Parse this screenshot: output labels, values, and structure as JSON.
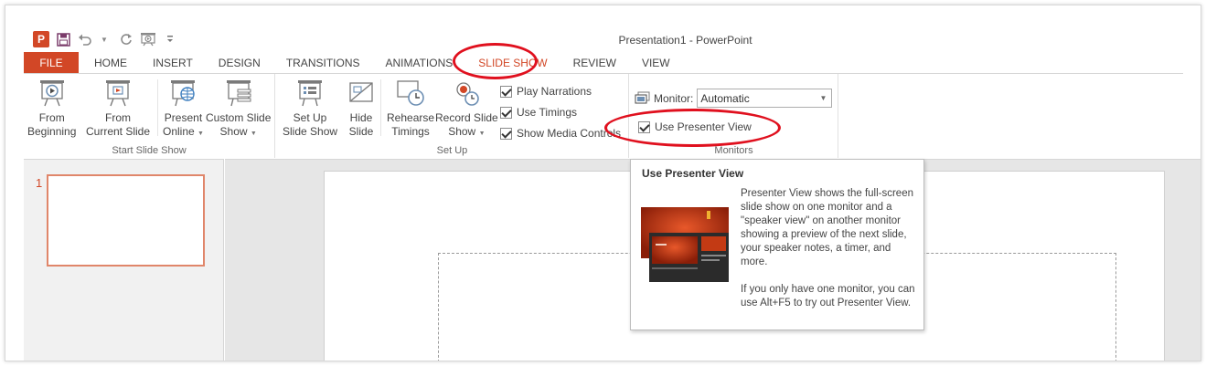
{
  "window": {
    "title": "Presentation1 - PowerPoint"
  },
  "app_icon": "P",
  "quick_access": [
    "save-icon",
    "undo-icon",
    "redo-icon",
    "start-from-beginning-icon",
    "customize-qat-icon"
  ],
  "tabs": [
    {
      "label": "FILE"
    },
    {
      "label": "HOME"
    },
    {
      "label": "INSERT"
    },
    {
      "label": "DESIGN"
    },
    {
      "label": "TRANSITIONS"
    },
    {
      "label": "ANIMATIONS"
    },
    {
      "label": "SLIDE SHOW"
    },
    {
      "label": "REVIEW"
    },
    {
      "label": "VIEW"
    }
  ],
  "ribbon": {
    "start_slide_show": {
      "label": "Start Slide Show",
      "from_beginning": {
        "line1": "From",
        "line2": "Beginning"
      },
      "from_current": {
        "line1": "From",
        "line2": "Current Slide"
      },
      "present_online": {
        "line1": "Present",
        "line2": "Online"
      },
      "custom_slide_show": {
        "line1": "Custom Slide",
        "line2": "Show"
      }
    },
    "set_up": {
      "label": "Set Up",
      "set_up_slide_show": {
        "line1": "Set Up",
        "line2": "Slide Show"
      },
      "hide_slide": {
        "line1": "Hide",
        "line2": "Slide"
      },
      "rehearse_timings": {
        "line1": "Rehearse",
        "line2": "Timings"
      },
      "record_slide_show": {
        "line1": "Record Slide",
        "line2": "Show"
      },
      "play_narrations": "Play Narrations",
      "use_timings": "Use Timings",
      "show_media_controls": "Show Media Controls"
    },
    "monitors": {
      "label": "Monitors",
      "monitor_label": "Monitor:",
      "monitor_value": "Automatic",
      "use_presenter_view": "Use Presenter View"
    }
  },
  "slides": [
    {
      "number": "1"
    }
  ],
  "tooltip": {
    "title": "Use Presenter View",
    "paragraph1": "Presenter View shows the full-screen slide show on one monitor and a \"speaker view\" on another monitor showing a preview of the next slide, your speaker notes, a timer, and more.",
    "paragraph2": "If you only have one monitor, you can use Alt+F5 to try out Presenter View."
  },
  "colors": {
    "accent": "#d24726",
    "annotation": "#e0101e"
  }
}
